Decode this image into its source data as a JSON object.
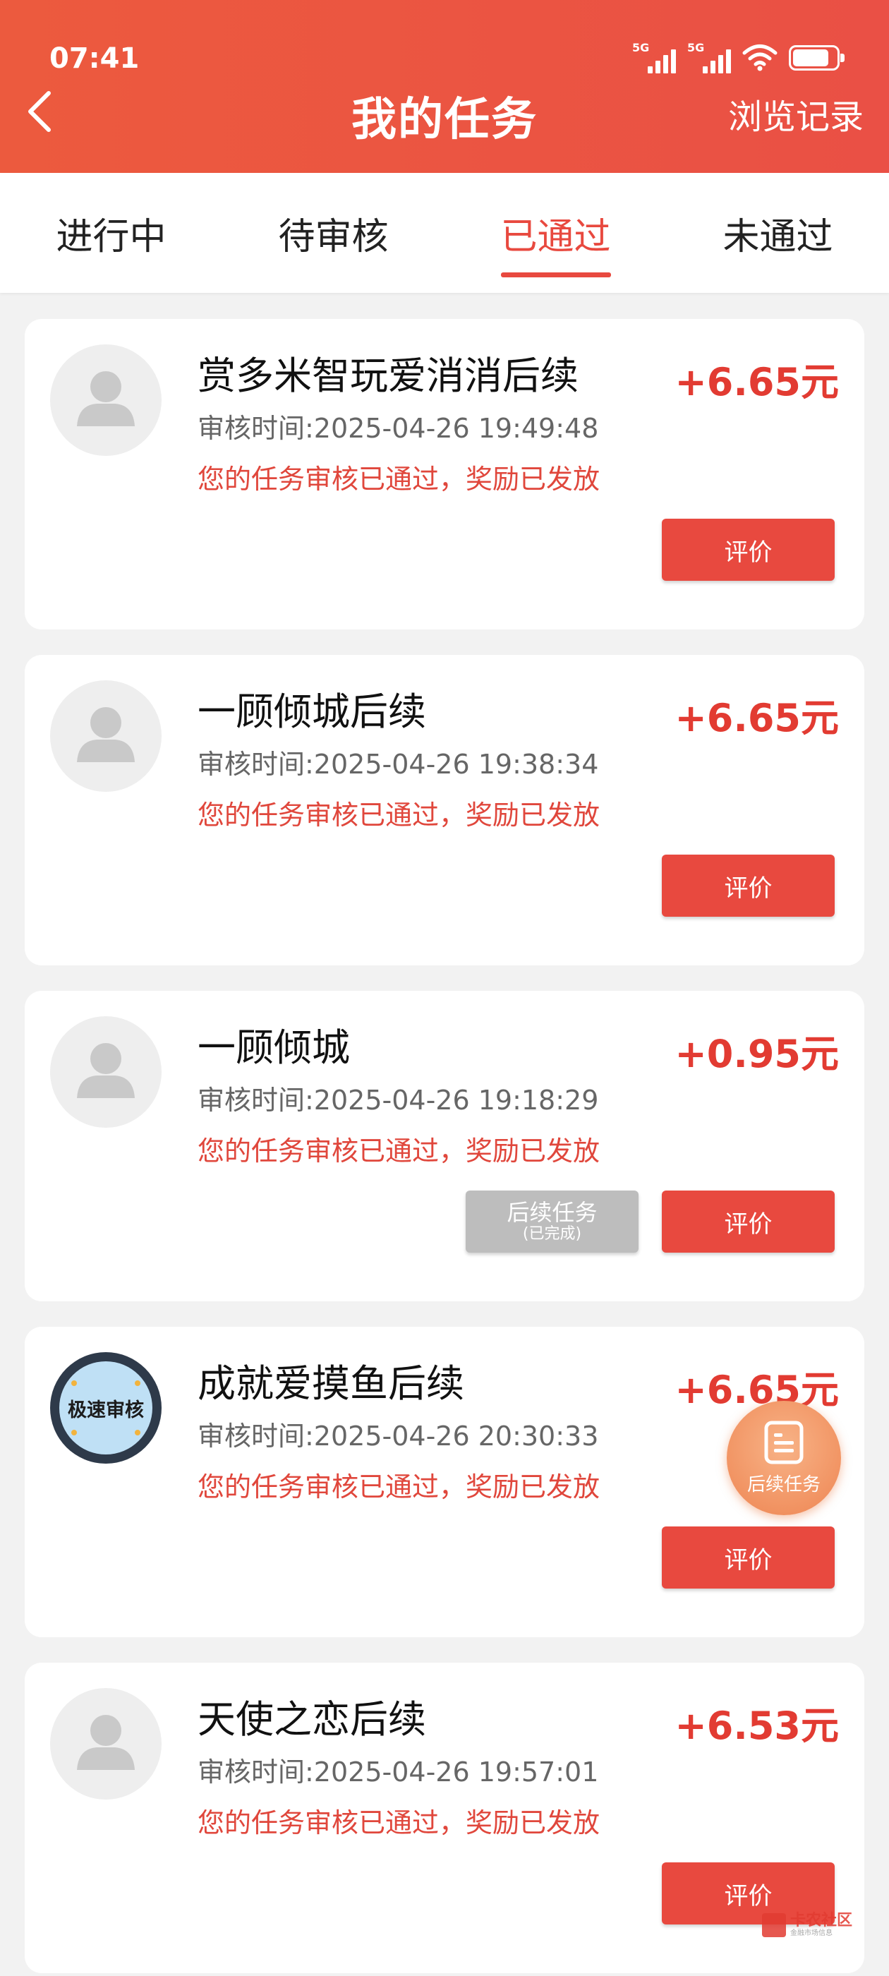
{
  "status_bar": {
    "time": "07:41",
    "network_1": "5G",
    "network_2": "5G",
    "battery_level": 0.85
  },
  "header": {
    "title": "我的任务",
    "history_link": "浏览记录"
  },
  "tabs": [
    {
      "label": "进行中",
      "active": false
    },
    {
      "label": "待审核",
      "active": false
    },
    {
      "label": "已通过",
      "active": true
    },
    {
      "label": "未通过",
      "active": false
    }
  ],
  "tasks": [
    {
      "title": "赏多米智玩爱消消后续",
      "reward": "+6.65元",
      "review_time": "审核时间:2025-04-26 19:49:48",
      "status": "您的任务审核已通过，奖励已发放",
      "rate_label": "评价",
      "avatar": "placeholder"
    },
    {
      "title": "一顾倾城后续",
      "reward": "+6.65元",
      "review_time": "审核时间:2025-04-26 19:38:34",
      "status": "您的任务审核已通过，奖励已发放",
      "rate_label": "评价",
      "avatar": "placeholder"
    },
    {
      "title": "一顾倾城",
      "reward": "+0.95元",
      "review_time": "审核时间:2025-04-26 19:18:29",
      "status": "您的任务审核已通过，奖励已发放",
      "rate_label": "评价",
      "avatar": "placeholder",
      "follow_up_label": "后续任务",
      "follow_up_sub": "(已完成)"
    },
    {
      "title": "成就爱摸鱼后续",
      "reward": "+6.65元",
      "review_time": "审核时间:2025-04-26 20:30:33",
      "status": "您的任务审核已通过，奖励已发放",
      "rate_label": "评价",
      "avatar": "badge",
      "badge_text": "极速审核"
    },
    {
      "title": "天使之恋后续",
      "reward": "+6.53元",
      "review_time": "审核时间:2025-04-26 19:57:01",
      "status": "您的任务审核已通过，奖励已发放",
      "rate_label": "评价",
      "avatar": "placeholder"
    }
  ],
  "fab": {
    "label": "后续任务",
    "icon": "document-icon"
  },
  "watermark": {
    "title": "卡农社区",
    "subtitle": "金融市场信息"
  },
  "colors": {
    "primary": "#e8493f",
    "header": "#ec5a3e",
    "reward": "#e23b32",
    "fab": "#ee8552"
  }
}
